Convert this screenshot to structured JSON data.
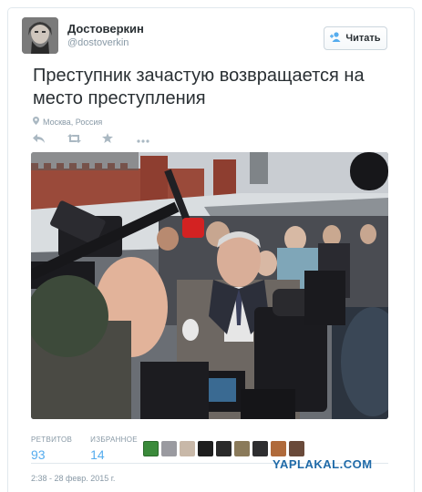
{
  "author": {
    "name": "Достоверкин",
    "handle": "@dostoverkin"
  },
  "follow_button": {
    "label": "Читать",
    "icon": "add-user-icon"
  },
  "tweet": {
    "text": "Преступник зачастую возвращается на место преступления",
    "location": "Москва, Россия"
  },
  "actions": [
    {
      "name": "reply",
      "icon": "reply-icon"
    },
    {
      "name": "retweet",
      "icon": "retweet-icon"
    },
    {
      "name": "favorite",
      "icon": "star-icon"
    },
    {
      "name": "more",
      "icon": "more-icon"
    }
  ],
  "stats": {
    "retweets_label": "РЕТВИТОВ",
    "retweets_value": "93",
    "favorites_label": "ИЗБРАННОЕ",
    "favorites_value": "14"
  },
  "timestamp": "2:38 - 28 февр. 2015 г.",
  "watermark": "YAPLAKAL.COM",
  "colors": {
    "accent": "#55acee",
    "text": "#292f33",
    "muted": "#8899a6",
    "watermark": "#1f6aa8"
  }
}
